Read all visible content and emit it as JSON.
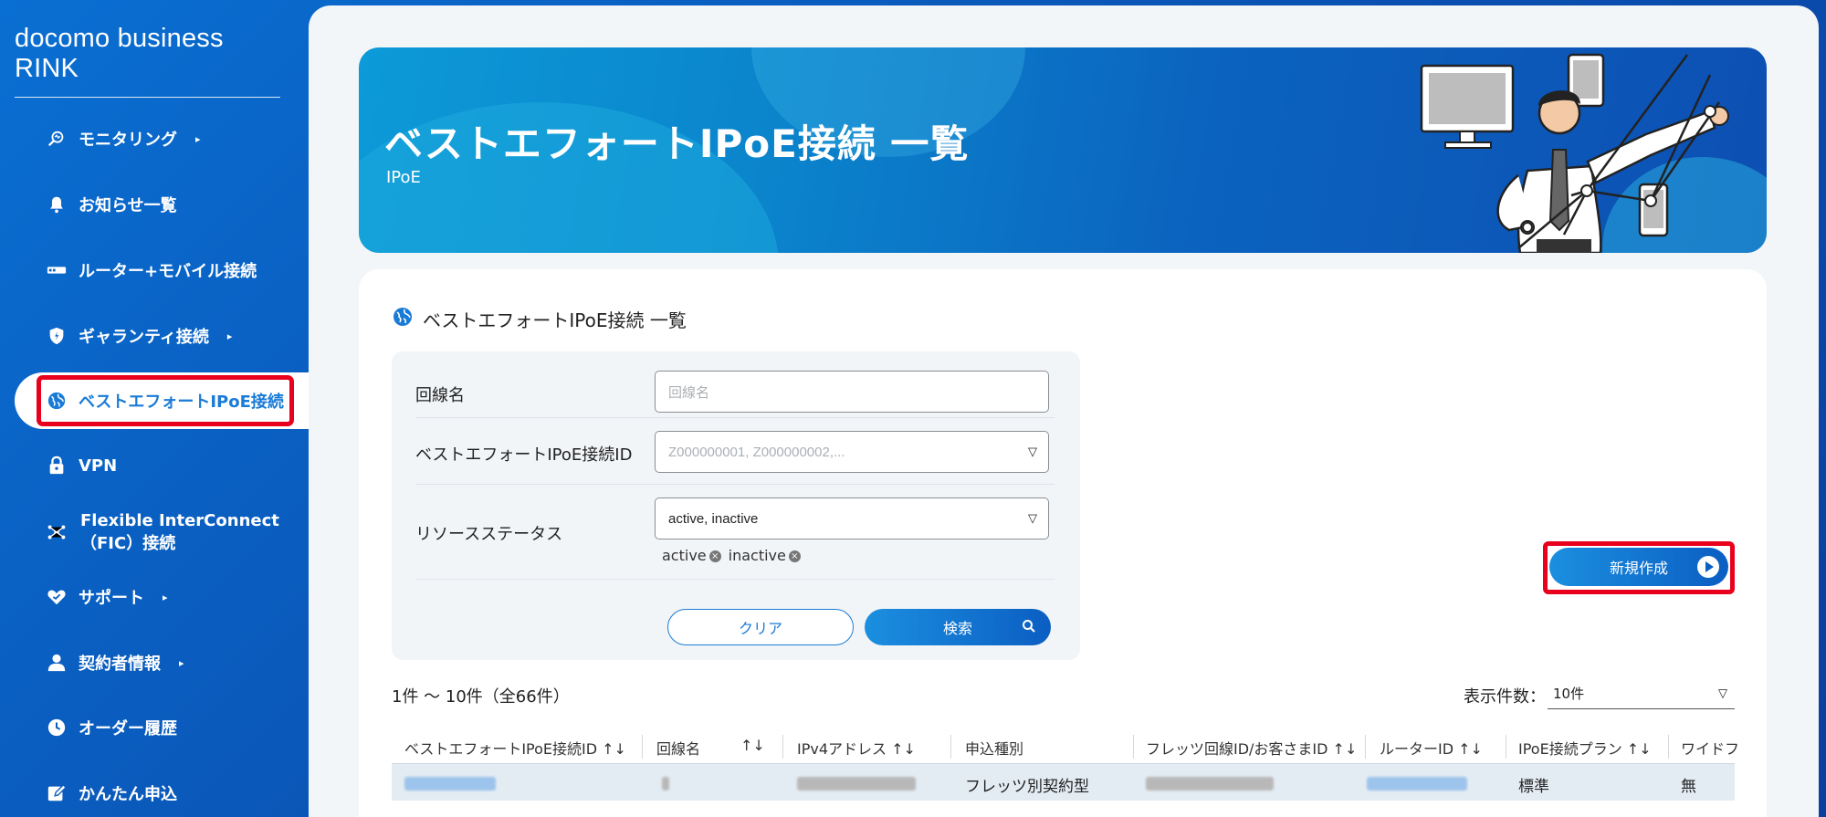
{
  "brand": "docomo business RINK",
  "sidebar": {
    "items": [
      {
        "label": "モニタリング",
        "icon": "monitoring-icon",
        "caret": "▸"
      },
      {
        "label": "お知らせ一覧",
        "icon": "bell-icon",
        "caret": ""
      },
      {
        "label": "ルーター+モバイル接続",
        "icon": "router-icon",
        "caret": ""
      },
      {
        "label": "ギャランティ接続",
        "icon": "shield-icon",
        "caret": "▸"
      },
      {
        "label": "ベストエフォートIPoE接続",
        "icon": "globe-icon",
        "caret": ""
      },
      {
        "label": "VPN",
        "icon": "lock-icon",
        "caret": ""
      },
      {
        "label": "Flexible InterConnect",
        "label2": "（FIC）接続",
        "icon": "network-icon",
        "caret": ""
      },
      {
        "label": "サポート",
        "icon": "support-icon",
        "caret": "▸"
      },
      {
        "label": "契約者情報",
        "icon": "user-icon",
        "caret": "▸"
      },
      {
        "label": "オーダー履歴",
        "icon": "clock-icon",
        "caret": ""
      },
      {
        "label": "かんたん申込",
        "icon": "edit-icon",
        "caret": ""
      }
    ],
    "active_index": 4
  },
  "hero": {
    "title": "ベストエフォートIPoE接続 一覧",
    "subtitle": "IPoE"
  },
  "card": {
    "title": "ベストエフォートIPoE接続 一覧"
  },
  "filter": {
    "line_name_label": "回線名",
    "line_name_placeholder": "回線名",
    "id_label": "ベストエフォートIPoE接続ID",
    "id_placeholder": "Z000000001, Z000000002,...",
    "status_label": "リソースステータス",
    "status_value": "active, inactive",
    "status_chips": [
      "active",
      "inactive"
    ],
    "clear_label": "クリア",
    "search_label": "検索"
  },
  "new_button": "新規作成",
  "pagination": {
    "count_text": "1件 ～ 10件（全66件）",
    "per_page_label": "表示件数：",
    "per_page_value": "10件"
  },
  "table": {
    "headers": [
      "ベストエフォートIPoE接続ID ↑↓",
      "回線名",
      "↑↓",
      "IPv4アドレス ↑↓",
      "申込種別",
      "フレッツ回線ID/お客さまID ↑↓",
      "ルーターID ↑↓",
      "IPoE接続プラン ↑↓",
      "ワイドフ"
    ],
    "rows": [
      {
        "apply_type": "フレッツ別契約型",
        "plan": "標準",
        "wide": "無"
      }
    ]
  },
  "colors": {
    "accent": "#1a7bd6",
    "highlight": "#e8001c",
    "sidebar": "#0a5fc0"
  }
}
